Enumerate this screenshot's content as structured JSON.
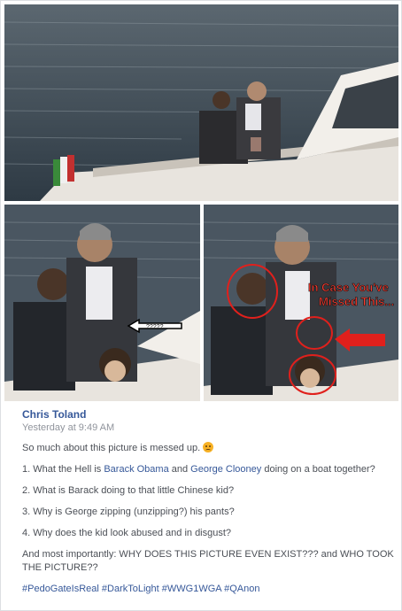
{
  "post": {
    "author": "Chris Toland",
    "timestamp": "Yesterday at 9:49 AM",
    "intro": "So much about this picture is messed up.",
    "emoji": "angry-face-emoji",
    "q1_prefix": "1. What the Hell is ",
    "q1_link1": "Barack Obama",
    "q1_mid": " and ",
    "q1_link2": "George Clooney",
    "q1_suffix": " doing on a boat together?",
    "q2": "2. What is Barack doing to that little Chinese kid?",
    "q3": "3. Why is George zipping (unzipping?) his pants?",
    "q4": "4. Why does the kid look abused and in disgust?",
    "closing": "And most importantly: WHY DOES THIS PICTURE EVEN EXIST??? and WHO TOOK THE PICTURE??",
    "hashtags": [
      "#PedoGateIsReal",
      "#DarkToLight",
      "#WWG1WGA",
      "#QAnon"
    ]
  },
  "photos": {
    "left_annotation": "?????",
    "right_annotation": "In Case You've Missed This..."
  },
  "colors": {
    "link": "#365899",
    "annotation_red": "#e0201c",
    "water": "#3c4a55",
    "boat_white": "#e8e4de"
  }
}
